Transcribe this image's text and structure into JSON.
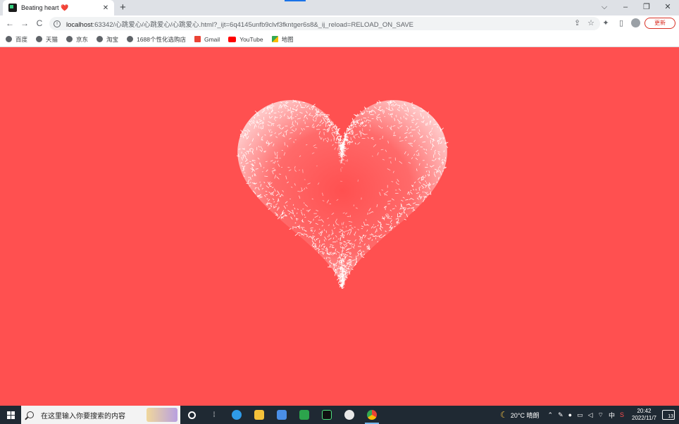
{
  "browser": {
    "tab": {
      "title": "Beating heart ❤️",
      "close": "✕"
    },
    "new_tab": "+",
    "window_controls": {
      "dropdown": "⌵",
      "minimize": "–",
      "restore": "❐",
      "close": "✕"
    },
    "nav": {
      "back": "←",
      "forward": "→",
      "reload": "C"
    },
    "address": {
      "host": "localhost",
      "rest": ":63342/心跳爱心/心跳爱心/心跳爱心.html?_ijt=6q4145unfb9clvf3fkntger6s8&_ij_reload=RELOAD_ON_SAVE"
    },
    "update_button": "更新"
  },
  "bookmarks": [
    {
      "label": "百度",
      "icon": "globe-icon"
    },
    {
      "label": "天猫",
      "icon": "globe-icon"
    },
    {
      "label": "京东",
      "icon": "globe-icon"
    },
    {
      "label": "淘宝",
      "icon": "globe-icon"
    },
    {
      "label": "1688个性化选购店",
      "icon": "globe-icon"
    },
    {
      "label": "Gmail",
      "icon": "gmail-icon"
    },
    {
      "label": "YouTube",
      "icon": "youtube-icon"
    },
    {
      "label": "地图",
      "icon": "maps-icon"
    }
  ],
  "page": {
    "background": "#ff5050",
    "heart_color": "#ffffff"
  },
  "taskbar": {
    "search_placeholder": "在这里输入你要搜索的内容",
    "weather": {
      "temp": "20°C",
      "condition": "晴朗"
    },
    "ime": "中",
    "clock": {
      "time": "20:42",
      "date": "2022/11/7"
    },
    "notifications": "13"
  }
}
